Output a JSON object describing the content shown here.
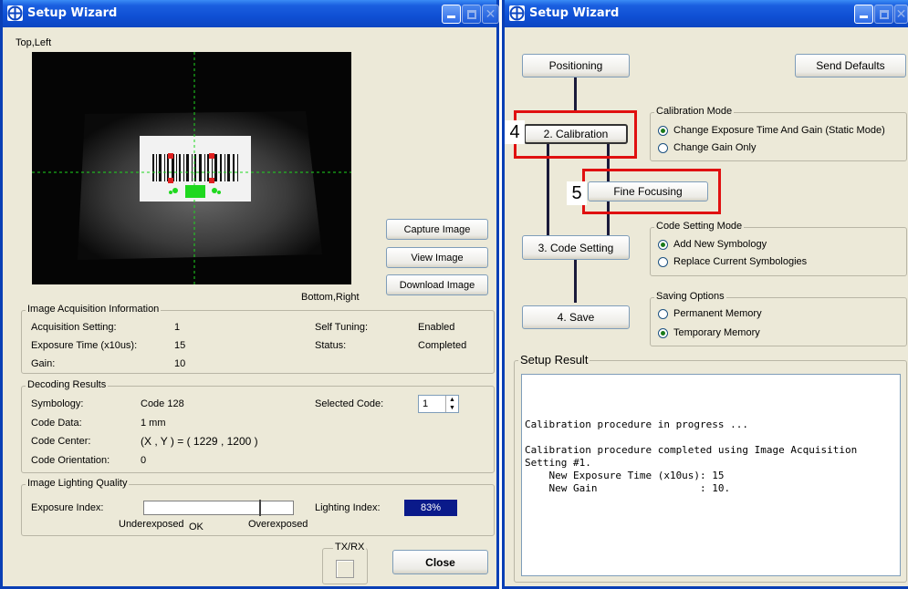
{
  "left_window": {
    "title": "Setup Wizard",
    "corner_top_left": "Top,Left",
    "corner_bottom_right": "Bottom,Right",
    "buttons": {
      "capture": "Capture Image",
      "view": "View Image",
      "download": "Download Image",
      "close": "Close"
    },
    "acquisition": {
      "legend": "Image Acquisition Information",
      "setting_label": "Acquisition Setting:",
      "setting_value": "1",
      "exposure_label": "Exposure Time (x10us):",
      "exposure_value": "15",
      "gain_label": "Gain:",
      "gain_value": "10",
      "self_tuning_label": "Self Tuning:",
      "self_tuning_value": "Enabled",
      "status_label": "Status:",
      "status_value": "Completed"
    },
    "decoding": {
      "legend": "Decoding Results",
      "symbology_label": "Symbology:",
      "symbology_value": "Code 128",
      "data_label": "Code Data:",
      "data_value": "1 mm",
      "center_label": "Code Center:",
      "center_value": "(X , Y ) = ( 1229 , 1200 )",
      "orientation_label": "Code Orientation:",
      "orientation_value": "0",
      "selected_label": "Selected Code:",
      "selected_value": "1"
    },
    "lighting": {
      "legend": "Image Lighting Quality",
      "exposure_index_label": "Exposure Index:",
      "under_label": "Underexposed",
      "ok_label": "OK",
      "over_label": "Overexposed",
      "lighting_index_label": "Lighting Index:",
      "lighting_index_value": "83%",
      "exposure_slider_fraction": 0.78
    },
    "txrx_label": "TX/RX"
  },
  "right_window": {
    "title": "Setup Wizard",
    "buttons": {
      "positioning": "Positioning",
      "send_defaults": "Send Defaults",
      "calibration": "2. Calibration",
      "fine_focusing": "Fine Focusing",
      "code_setting": "3. Code Setting",
      "save": "4. Save"
    },
    "calibration_mode": {
      "legend": "Calibration Mode",
      "option1": "Change Exposure Time And Gain (Static Mode)",
      "option2": "Change Gain Only",
      "selected": 1
    },
    "code_setting_mode": {
      "legend": "Code Setting Mode",
      "option1": "Add New Symbology",
      "option2": "Replace Current Symbologies",
      "selected": 1
    },
    "saving_options": {
      "legend": "Saving Options",
      "option1": "Permanent Memory",
      "option2": "Temporary Memory",
      "selected": 2
    },
    "setup_result": {
      "legend": "Setup Result",
      "line1": "Calibration procedure in progress ...",
      "line2": "Calibration procedure completed using Image Acquisition",
      "line3": "Setting #1.",
      "line4": "    New Exposure Time (x10us): 15",
      "line5": "    New Gain                 : 10."
    }
  },
  "callouts": {
    "calibration": "4",
    "fine_focusing": "5"
  },
  "colors": {
    "title_bar": "#0f4fd4",
    "highlight_red": "#e01010",
    "lighting_index_bg": "#0a1a8a",
    "window_bg": "#ece9d8"
  }
}
